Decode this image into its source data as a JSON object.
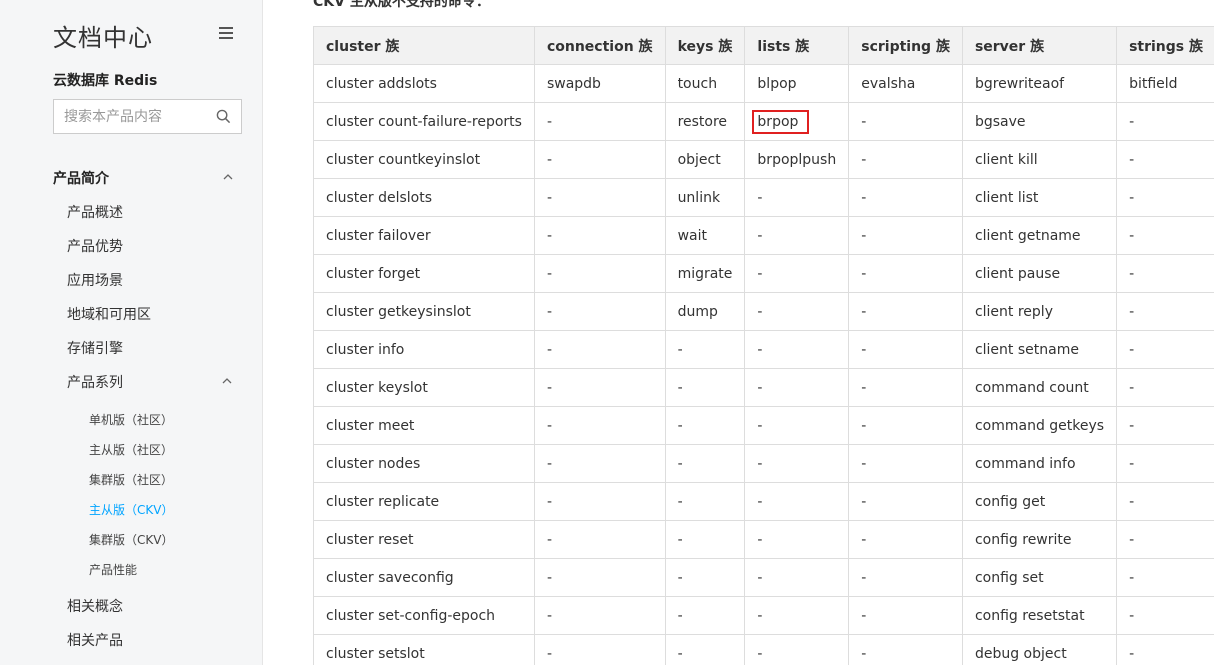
{
  "sidebar": {
    "title": "文档中心",
    "product": "云数据库 Redis",
    "search_placeholder": "搜索本产品内容",
    "section": "产品简介",
    "items": [
      "产品概述",
      "产品优势",
      "应用场景",
      "地域和可用区",
      "存储引擎",
      "产品系列"
    ],
    "sub_items": [
      "单机版（社区）",
      "主从版（社区）",
      "集群版（社区）",
      "主从版（CKV）",
      "集群版（CKV）",
      "产品性能"
    ],
    "active_sub_index": 3,
    "bottom_items": [
      "相关概念",
      "相关产品"
    ],
    "active_color": "#00a4ff"
  },
  "main": {
    "caption": "CKV 主从版不支持的命令：",
    "highlight": {
      "row": 1,
      "col": 3,
      "color": "#e02020"
    },
    "table": {
      "headers": [
        "cluster 族",
        "connection 族",
        "keys 族",
        "lists 族",
        "scripting 族",
        "server 族",
        "strings 族"
      ],
      "rows": [
        [
          "cluster addslots",
          "swapdb",
          "touch",
          "blpop",
          "evalsha",
          "bgrewriteaof",
          "bitfield"
        ],
        [
          "cluster count-failure-reports",
          "-",
          "restore",
          "brpop",
          "-",
          "bgsave",
          "-"
        ],
        [
          "cluster countkeyinslot",
          "-",
          "object",
          "brpoplpush",
          "-",
          "client kill",
          "-"
        ],
        [
          "cluster delslots",
          "-",
          "unlink",
          "-",
          "-",
          "client list",
          "-"
        ],
        [
          "cluster failover",
          "-",
          "wait",
          "-",
          "-",
          "client getname",
          "-"
        ],
        [
          "cluster forget",
          "-",
          "migrate",
          "-",
          "-",
          "client pause",
          "-"
        ],
        [
          "cluster getkeysinslot",
          "-",
          "dump",
          "-",
          "-",
          "client reply",
          "-"
        ],
        [
          "cluster info",
          "-",
          "-",
          "-",
          "-",
          "client setname",
          "-"
        ],
        [
          "cluster keyslot",
          "-",
          "-",
          "-",
          "-",
          "command count",
          "-"
        ],
        [
          "cluster meet",
          "-",
          "-",
          "-",
          "-",
          "command getkeys",
          "-"
        ],
        [
          "cluster nodes",
          "-",
          "-",
          "-",
          "-",
          "command info",
          "-"
        ],
        [
          "cluster replicate",
          "-",
          "-",
          "-",
          "-",
          "config get",
          "-"
        ],
        [
          "cluster reset",
          "-",
          "-",
          "-",
          "-",
          "config rewrite",
          "-"
        ],
        [
          "cluster saveconfig",
          "-",
          "-",
          "-",
          "-",
          "config set",
          "-"
        ],
        [
          "cluster set-config-epoch",
          "-",
          "-",
          "-",
          "-",
          "config resetstat",
          "-"
        ],
        [
          "cluster setslot",
          "-",
          "-",
          "-",
          "-",
          "debug object",
          "-"
        ]
      ]
    }
  }
}
